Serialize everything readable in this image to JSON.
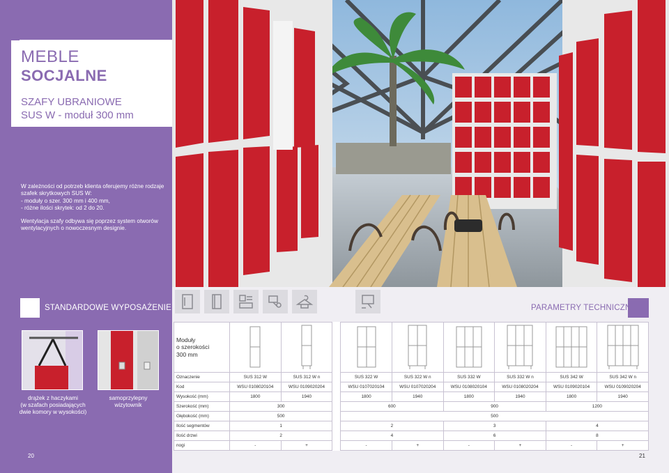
{
  "left": {
    "title_line1": "MEBLE",
    "title_line2": "SOCJALNE",
    "subtitle_line1": "SZAFY UBRANIOWE",
    "subtitle_line2": "SUS W - moduł 300 mm",
    "desc_p1": [
      "W zależności od potrzeb klienta oferujemy różne rodzaje",
      "szafek skrytkowych SUS W:",
      "- moduły o szer. 300 mm i 400 mm,",
      "- różne ilości skrytek: od 2 do 20."
    ],
    "desc_p2": [
      "Wentylacja szafy odbywa się poprzez system otworów",
      "wentylacyjnych o nowoczesnym designie."
    ]
  },
  "standard": {
    "header": "STANDARDOWE WYPOSAŻENIE",
    "accessories": [
      {
        "caption": [
          "drążek z haczykami",
          "(w szafach posiadających",
          "dwie komory w wysokości)"
        ]
      },
      {
        "caption": [
          "samoprzylepny",
          "wizytownik"
        ]
      }
    ]
  },
  "params": {
    "header": "PARAMETRY TECHNICZNE",
    "modules_label": [
      "Moduły",
      "o szerokości",
      "300 mm"
    ],
    "rows": {
      "oznaczenie": {
        "label": "Oznaczenie",
        "values": [
          "SUS 312 W",
          "SUS 312 W n",
          "SUS 322 W",
          "SUS 322 W n",
          "SUS 332 W",
          "SUS 332 W n",
          "SUS 342 W",
          "SUS 342 W n"
        ]
      },
      "kod": {
        "label": "Kod",
        "values": [
          "WSU 0108020104",
          "WSU 0109020204",
          "WSU 0107020104",
          "WSU 0107020204",
          "WSU 0108020104",
          "WSU 0108020204",
          "WSU 0109020104",
          "WSU 0109020204"
        ]
      },
      "wysokosc": {
        "label": "Wysokość (mm)",
        "values": [
          "1800",
          "1940",
          "1800",
          "1940",
          "1800",
          "1940",
          "1800",
          "1940"
        ]
      },
      "szerokosc": {
        "label": "Szerokość (mm)",
        "values": [
          "300",
          "600",
          "900",
          "1200"
        ]
      },
      "glebokosc": {
        "label": "Głębokość (mm)",
        "values": [
          "500",
          "500"
        ]
      },
      "segmenty": {
        "label": "Ilość segmentów",
        "values": [
          "1",
          "2",
          "3",
          "4"
        ]
      },
      "drzwi": {
        "label": "Ilość drzwi",
        "values": [
          "2",
          "4",
          "6",
          "8"
        ]
      },
      "nogi": {
        "label": "nogi",
        "values": [
          "-",
          "+",
          "-",
          "+",
          "-",
          "+",
          "-",
          "+"
        ]
      }
    }
  },
  "pages": {
    "left": "20",
    "right": "21"
  },
  "colors": {
    "accent": "#8a6bb1",
    "locker_red": "#c8202c",
    "band": "#f0eef3"
  }
}
